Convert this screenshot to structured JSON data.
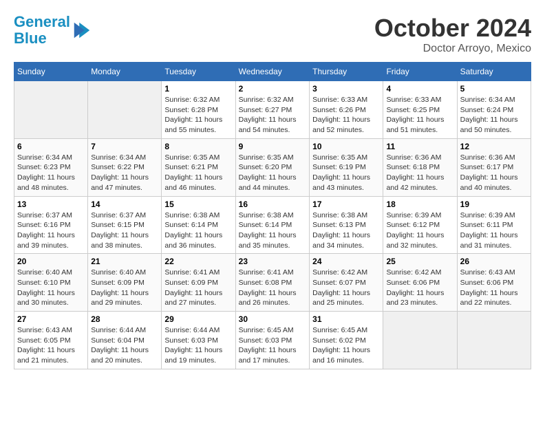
{
  "header": {
    "logo_line1": "General",
    "logo_line2": "Blue",
    "month": "October 2024",
    "location": "Doctor Arroyo, Mexico"
  },
  "weekdays": [
    "Sunday",
    "Monday",
    "Tuesday",
    "Wednesday",
    "Thursday",
    "Friday",
    "Saturday"
  ],
  "weeks": [
    [
      {
        "day": "",
        "empty": true
      },
      {
        "day": "",
        "empty": true
      },
      {
        "day": "1",
        "sunrise": "6:32 AM",
        "sunset": "6:28 PM",
        "daylight": "11 hours and 55 minutes."
      },
      {
        "day": "2",
        "sunrise": "6:32 AM",
        "sunset": "6:27 PM",
        "daylight": "11 hours and 54 minutes."
      },
      {
        "day": "3",
        "sunrise": "6:33 AM",
        "sunset": "6:26 PM",
        "daylight": "11 hours and 52 minutes."
      },
      {
        "day": "4",
        "sunrise": "6:33 AM",
        "sunset": "6:25 PM",
        "daylight": "11 hours and 51 minutes."
      },
      {
        "day": "5",
        "sunrise": "6:34 AM",
        "sunset": "6:24 PM",
        "daylight": "11 hours and 50 minutes."
      }
    ],
    [
      {
        "day": "6",
        "sunrise": "6:34 AM",
        "sunset": "6:23 PM",
        "daylight": "11 hours and 48 minutes."
      },
      {
        "day": "7",
        "sunrise": "6:34 AM",
        "sunset": "6:22 PM",
        "daylight": "11 hours and 47 minutes."
      },
      {
        "day": "8",
        "sunrise": "6:35 AM",
        "sunset": "6:21 PM",
        "daylight": "11 hours and 46 minutes."
      },
      {
        "day": "9",
        "sunrise": "6:35 AM",
        "sunset": "6:20 PM",
        "daylight": "11 hours and 44 minutes."
      },
      {
        "day": "10",
        "sunrise": "6:35 AM",
        "sunset": "6:19 PM",
        "daylight": "11 hours and 43 minutes."
      },
      {
        "day": "11",
        "sunrise": "6:36 AM",
        "sunset": "6:18 PM",
        "daylight": "11 hours and 42 minutes."
      },
      {
        "day": "12",
        "sunrise": "6:36 AM",
        "sunset": "6:17 PM",
        "daylight": "11 hours and 40 minutes."
      }
    ],
    [
      {
        "day": "13",
        "sunrise": "6:37 AM",
        "sunset": "6:16 PM",
        "daylight": "11 hours and 39 minutes."
      },
      {
        "day": "14",
        "sunrise": "6:37 AM",
        "sunset": "6:15 PM",
        "daylight": "11 hours and 38 minutes."
      },
      {
        "day": "15",
        "sunrise": "6:38 AM",
        "sunset": "6:14 PM",
        "daylight": "11 hours and 36 minutes."
      },
      {
        "day": "16",
        "sunrise": "6:38 AM",
        "sunset": "6:14 PM",
        "daylight": "11 hours and 35 minutes."
      },
      {
        "day": "17",
        "sunrise": "6:38 AM",
        "sunset": "6:13 PM",
        "daylight": "11 hours and 34 minutes."
      },
      {
        "day": "18",
        "sunrise": "6:39 AM",
        "sunset": "6:12 PM",
        "daylight": "11 hours and 32 minutes."
      },
      {
        "day": "19",
        "sunrise": "6:39 AM",
        "sunset": "6:11 PM",
        "daylight": "11 hours and 31 minutes."
      }
    ],
    [
      {
        "day": "20",
        "sunrise": "6:40 AM",
        "sunset": "6:10 PM",
        "daylight": "11 hours and 30 minutes."
      },
      {
        "day": "21",
        "sunrise": "6:40 AM",
        "sunset": "6:09 PM",
        "daylight": "11 hours and 29 minutes."
      },
      {
        "day": "22",
        "sunrise": "6:41 AM",
        "sunset": "6:09 PM",
        "daylight": "11 hours and 27 minutes."
      },
      {
        "day": "23",
        "sunrise": "6:41 AM",
        "sunset": "6:08 PM",
        "daylight": "11 hours and 26 minutes."
      },
      {
        "day": "24",
        "sunrise": "6:42 AM",
        "sunset": "6:07 PM",
        "daylight": "11 hours and 25 minutes."
      },
      {
        "day": "25",
        "sunrise": "6:42 AM",
        "sunset": "6:06 PM",
        "daylight": "11 hours and 23 minutes."
      },
      {
        "day": "26",
        "sunrise": "6:43 AM",
        "sunset": "6:06 PM",
        "daylight": "11 hours and 22 minutes."
      }
    ],
    [
      {
        "day": "27",
        "sunrise": "6:43 AM",
        "sunset": "6:05 PM",
        "daylight": "11 hours and 21 minutes."
      },
      {
        "day": "28",
        "sunrise": "6:44 AM",
        "sunset": "6:04 PM",
        "daylight": "11 hours and 20 minutes."
      },
      {
        "day": "29",
        "sunrise": "6:44 AM",
        "sunset": "6:03 PM",
        "daylight": "11 hours and 19 minutes."
      },
      {
        "day": "30",
        "sunrise": "6:45 AM",
        "sunset": "6:03 PM",
        "daylight": "11 hours and 17 minutes."
      },
      {
        "day": "31",
        "sunrise": "6:45 AM",
        "sunset": "6:02 PM",
        "daylight": "11 hours and 16 minutes."
      },
      {
        "day": "",
        "empty": true
      },
      {
        "day": "",
        "empty": true
      }
    ]
  ]
}
